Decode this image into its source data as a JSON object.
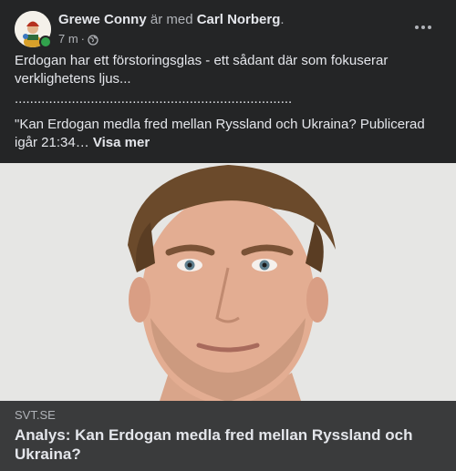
{
  "post": {
    "author": "Grewe Conny",
    "is_with_text": "är med",
    "tagged_person": "Carl Norberg",
    "trailing_period": ".",
    "timestamp": "7 m",
    "separator": "·",
    "privacy_icon": "globe-icon",
    "more_icon": "more-horizontal-icon",
    "online_status_color": "#31a24c"
  },
  "text": {
    "line1": "Erdogan har ett förstoringsglas - ett sådant där som fokuserar verklighetens ljus...",
    "dots": ".......................................................................................................",
    "quote": "\"Kan Erdogan medla fred mellan Ryssland och Ukraina? Publicerad igår 21:34…",
    "see_more": "Visa mer"
  },
  "link": {
    "domain": "SVT.SE",
    "title": "Analys: Kan Erdogan medla fred mellan Ryssland och Ukraina?"
  }
}
